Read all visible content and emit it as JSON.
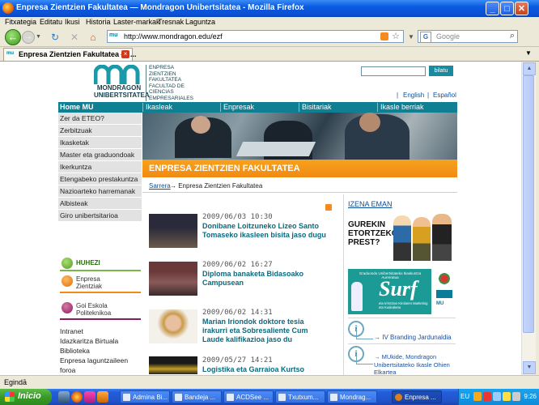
{
  "window": {
    "title": "Enpresa Zientzien Fakultatea — Mondragon Unibertsitatea - Mozilla Firefox",
    "min": "_",
    "max": "□",
    "close": "✕"
  },
  "menu": [
    "Fitxategia",
    "Editatu",
    "Ikusi",
    "Historia",
    "Laster-markak",
    "Tresnak",
    "Laguntza"
  ],
  "nav": {
    "url": "http://www.mondragon.edu/ezf",
    "search_placeholder": "Google",
    "fav": "mu"
  },
  "tab": {
    "label": "Enpresa Zientzien Fakultatea — ...",
    "close": "×"
  },
  "status": "Egindā",
  "page": {
    "logo_text": "MONDRAGON UNIBERTSITATEA",
    "faculty_lines": [
      "ENPRESA",
      "ZIENTZIEN",
      "FAKULTATEA",
      "FACULTAD DE",
      "CIENCIAS",
      "EMPRESARIALES"
    ],
    "search_button": "bilatu",
    "lang_sep": "|",
    "lang_en": "English",
    "lang_es": "Español",
    "topnav": [
      "Home MU",
      "Ikasleak",
      "Enpresak",
      "Bisitariak",
      "Ikasle berriak"
    ],
    "leftnav": [
      "Zer da ETEO?",
      "Zerbitzuak",
      "Ikasketak",
      "Master eta graduondoak",
      "Ikerkuntza",
      "Etengabeko prestakuntza",
      "Nazioarteko harremanak",
      "Albisteak",
      "Giro unibertsitarioa"
    ],
    "section_title": "ENPRESA ZIENTZIEN FAKULTATEA",
    "breadcrumb_home": "Sarrera",
    "breadcrumb_rest": "→ Enpresa Zientzien Fakultatea",
    "news": [
      {
        "date": "2009/06/03 10:30",
        "title": "Donibane Loitzuneko Lizeo Santo Tomaseko ikasleen bisita jaso dugu"
      },
      {
        "date": "2009/06/02 16:27",
        "title": "Diploma banaketa Bidasoako Campusean"
      },
      {
        "date": "2009/06/02 14:31",
        "title": "Marian Iriondok doktore tesia irakurri eta Sobresaliente Cum Laude kalifikazioa jaso du"
      },
      {
        "date": "2009/05/27 14:21",
        "title": "Logistika eta Garraioa Kurtso"
      }
    ],
    "izena": "IZENA EMAN",
    "promo1_text": "GUREKIN ETORTZEKO PREST?",
    "promo2_top": "Graduondo Unibertsitateko Ikaskuntza Aurreratua",
    "promo2_surf": "Surf",
    "promo2_bottom": "eta Irrintzian Kirolaren Marketing eta Kudeaketa",
    "promo2_side": "MU",
    "info1": "IV Branding Jardunaldia",
    "info2": "MUkide, Mondragon Unibertsitateko Ikasle Ohien Elkartea",
    "info_icon": "i",
    "side": [
      {
        "label": "HUHEZI",
        "color": "#7ab648"
      },
      {
        "label": "Enpresa Zientziak",
        "color": "#f08a12"
      },
      {
        "label": "Goi Eskola Politeknikoa",
        "color": "#8a1c5c"
      }
    ],
    "util_links": [
      "Intranet",
      "Idazkaritza Birtuala",
      "Biblioteka",
      "Enpresa laguntzaileen foroa"
    ]
  },
  "taskbar": {
    "start": "Inicio",
    "tasks": [
      "Admina Bi...",
      "Bandeja ...",
      "ACDSee ...",
      "Txutxum...",
      "Mondrag...",
      "Enpresa ..."
    ],
    "tray_lang": "EU",
    "clock": "9:26"
  }
}
